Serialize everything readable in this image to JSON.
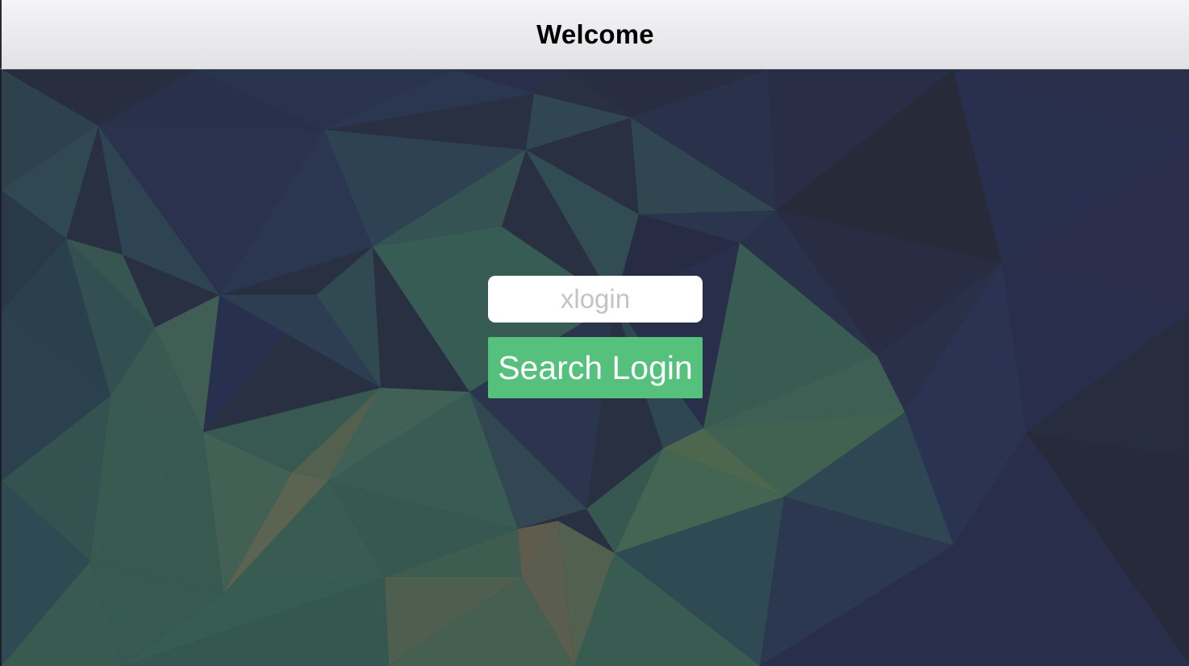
{
  "navbar": {
    "title": "Welcome"
  },
  "login": {
    "input_value": "",
    "input_placeholder": "xlogin",
    "button_label": "Search Login"
  },
  "colors": {
    "navbar_background": "#ececf0",
    "button_background": "#55c17d",
    "button_text": "#ffffff",
    "input_background": "#ffffff",
    "placeholder_text": "#c3c3c8",
    "background_dark": "#2c3142",
    "background_green": "#3e6a5a"
  }
}
